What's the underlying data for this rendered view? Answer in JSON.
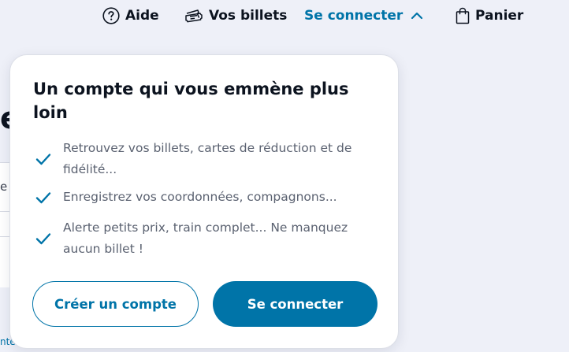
{
  "topnav": {
    "help": {
      "label": "Aide",
      "icon": "help-circle-icon"
    },
    "tickets": {
      "label": "Vos billets",
      "icon": "ticket-icon"
    },
    "login": {
      "label": "Se connecter",
      "icon": "chevron-up-icon",
      "color": "#0074a8"
    },
    "cart": {
      "label": "Panier",
      "icon": "shopping-bag-icon"
    }
  },
  "background": {
    "big_letter": "e",
    "small_letter": "e",
    "link_fragment": "nter"
  },
  "popover": {
    "title": "Un compte qui vous emmène plus loin",
    "benefits": [
      {
        "text": "Retrouvez vos billets, cartes de réduction et de fidélité...",
        "icon": "checkmark-icon"
      },
      {
        "text": "Enregistrez vos coordonnées, compagnons...",
        "icon": "checkmark-icon"
      },
      {
        "text": "Alerte petits prix, train complet... Ne manquez aucun billet !",
        "icon": "checkmark-icon"
      }
    ],
    "create_account_label": "Créer un compte",
    "login_label": "Se connecter"
  },
  "colors": {
    "accent": "#0074a8",
    "page_background": "#eef0f8",
    "text_dark": "#0c131f",
    "text_muted": "#5a6170"
  }
}
